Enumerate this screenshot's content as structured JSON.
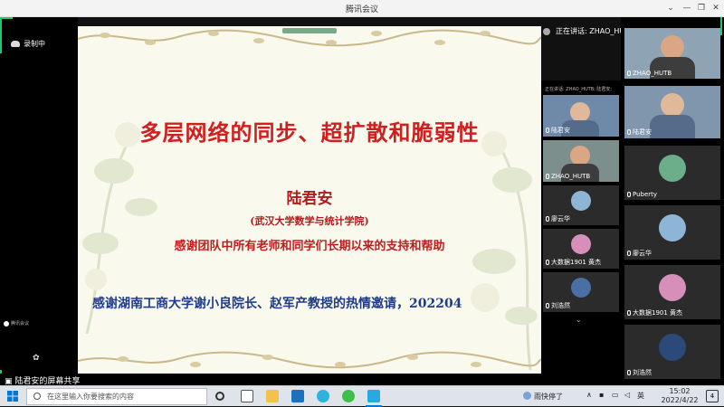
{
  "window": {
    "title": "腾讯会议",
    "minimize_glyph": "—",
    "restore_glyph": "❐",
    "close_glyph": "✕",
    "menu_glyph": "⌄"
  },
  "meeting": {
    "recording_label": "录制中",
    "speaking_label": "正在讲话: ZHAO_HUTB; 陆君安;",
    "share_label": "陆君安的屏幕共享",
    "mini_user_label": "腾讯会议",
    "mini_speaking_label": "正在讲话: ZHAO_HUTB; 陆君安;"
  },
  "slide": {
    "title": "多层网络的同步、超扩散和脆弱性",
    "author": "陆君安",
    "affiliation": "(武汉大学数学与统计学院)",
    "thanks": "感谢团队中所有老师和同学们长期以来的支持和帮助",
    "invite": "感谢湖南工商大学谢小良院长、赵军产教授的热情邀请，202204"
  },
  "participants_mid": [
    {
      "name": "陆君安",
      "kind": "video"
    },
    {
      "name": "ZHAO_HUTB",
      "kind": "video"
    },
    {
      "name": "廖云华",
      "kind": "avatar",
      "color": "#8fb5d6"
    },
    {
      "name": "大数据1901 黄杰",
      "kind": "avatar",
      "color": "#d68fb9"
    },
    {
      "name": "刘浩然",
      "kind": "avatar",
      "color": "#4a6fa5"
    }
  ],
  "participants_right": [
    {
      "name": "ZHAO_HUTB",
      "kind": "video"
    },
    {
      "name": "陆君安",
      "kind": "video"
    },
    {
      "name": "Puberty",
      "kind": "avatar",
      "color": "#6cae8a"
    },
    {
      "name": "廖云华",
      "kind": "avatar",
      "color": "#8fb5d6"
    },
    {
      "name": "大数据1901 黄杰",
      "kind": "avatar",
      "color": "#d68fb9"
    },
    {
      "name": "刘浩然",
      "kind": "avatar",
      "color": "#2b4a7a"
    }
  ],
  "taskbar": {
    "search_placeholder": "在这里输入你要搜索的内容",
    "weather": "雨快停了",
    "ime": "英",
    "time": "15:02",
    "date": "2022/4/22",
    "notify_count": "4",
    "icons": [
      "task-view-icon",
      "file-explorer-icon",
      "mail-icon",
      "edge-icon",
      "wechat-icon",
      "tencent-meeting-icon"
    ]
  },
  "colors": {
    "accent_green": "#1cc96e",
    "title_red": "#d11f1f",
    "invite_blue": "#1e3c8a"
  }
}
